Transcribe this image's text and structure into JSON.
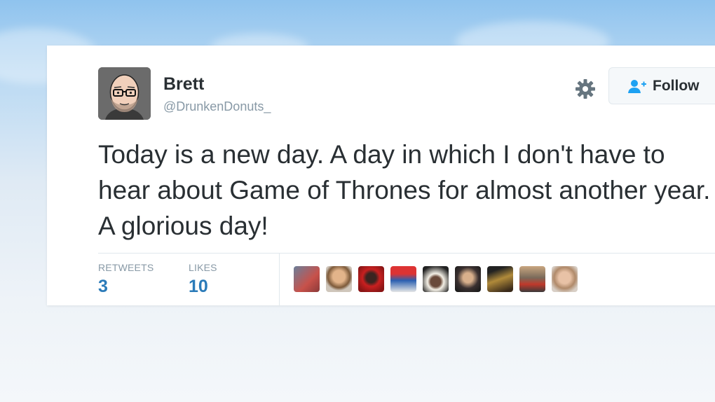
{
  "author": {
    "name": "Brett",
    "handle": "@DrunkenDonuts_"
  },
  "follow_button": {
    "label": "Follow",
    "icon": "person-add-icon"
  },
  "settings_icon": "gear-icon",
  "tweet": {
    "text": "Today is a new day. A day in which I don't have to hear about Game of Thrones for almost another year. A glorious day!"
  },
  "stats": {
    "retweets_label": "RETWEETS",
    "retweets_count": "3",
    "likes_label": "LIKES",
    "likes_count": "10"
  },
  "colors": {
    "link_blue": "#2b7bb9",
    "text": "#292f33",
    "muted": "#8899a6",
    "follow_icon": "#1da1f2"
  },
  "likers_count_shown": 9
}
